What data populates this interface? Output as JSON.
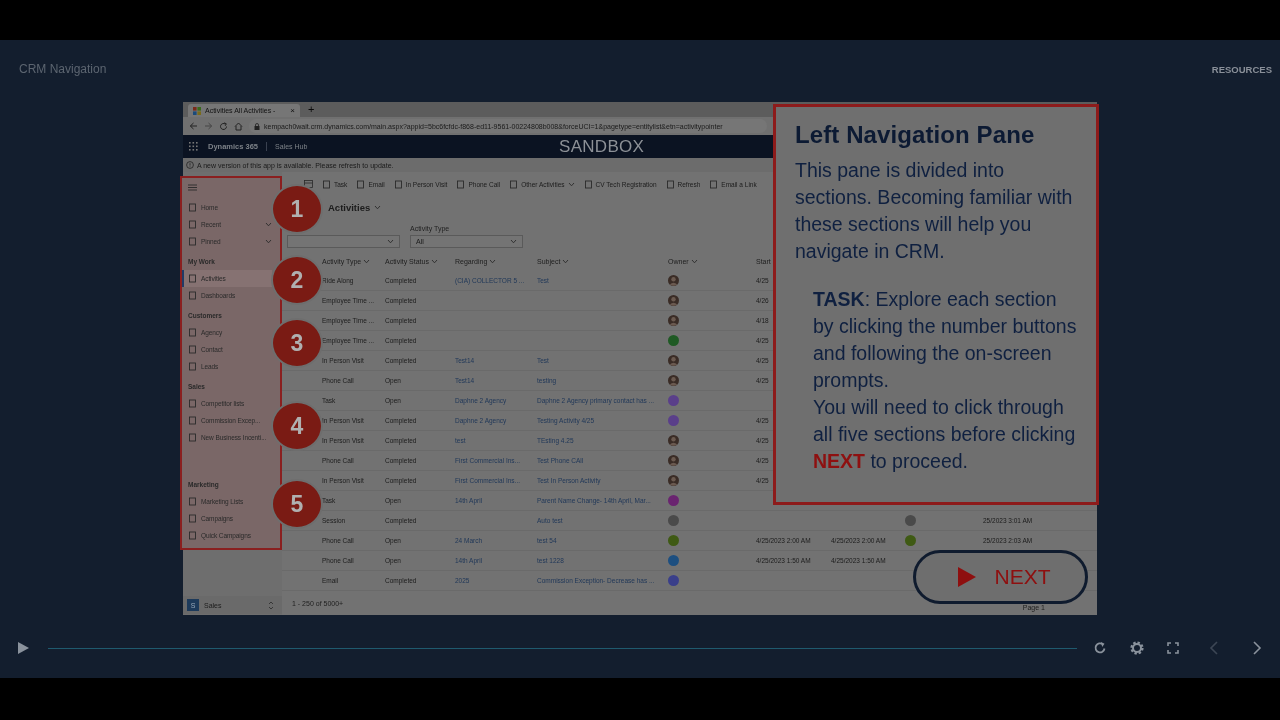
{
  "player": {
    "title": "CRM Navigation",
    "resources": "RESOURCES"
  },
  "browser": {
    "tab_title": "Activities All Activities -",
    "tab_close": "×",
    "new_tab": "+",
    "url": "kempach0wait.crm.dynamics.com/main.aspx?appid=5bc6fcfdc-f868-ed11-9561-00224808b008&forceUCI=1&pagetype=entitylist&etn=activitypointer"
  },
  "app_header": {
    "product": "Dynamics 365",
    "app": "Sales Hub",
    "environment": "SANDBOX"
  },
  "notification": "A new version of this app is available. Please refresh to update.",
  "sidebar": {
    "top_items": [
      {
        "label": "Home",
        "expandable": false
      },
      {
        "label": "Recent",
        "expandable": true
      },
      {
        "label": "Pinned",
        "expandable": true
      }
    ],
    "groups": [
      {
        "header": "My Work",
        "items": [
          {
            "label": "Activities",
            "selected": true
          },
          {
            "label": "Dashboards",
            "selected": false
          }
        ]
      },
      {
        "header": "Customers",
        "items": [
          {
            "label": "Agency",
            "selected": false
          },
          {
            "label": "Contact",
            "selected": false
          },
          {
            "label": "Leads",
            "selected": false
          }
        ]
      },
      {
        "header": "Sales",
        "items": [
          {
            "label": "Competitor lists",
            "selected": false
          },
          {
            "label": "Commission Excep...",
            "selected": false
          },
          {
            "label": "New Business Incenti...",
            "selected": false
          }
        ]
      },
      {
        "header": "Marketing",
        "items": [
          {
            "label": "Marketing Lists",
            "selected": false
          },
          {
            "label": "Campaigns",
            "selected": false
          },
          {
            "label": "Quick Campaigns",
            "selected": false
          }
        ]
      }
    ],
    "area_switcher": {
      "badge": "S",
      "label": "Sales"
    }
  },
  "command_bar": [
    "Task",
    "Email",
    "In Person Visit",
    "Phone Call",
    "Other Activities",
    "CV Tech Registration",
    "Refresh",
    "Email a Link"
  ],
  "view": {
    "title": "Activities",
    "filters": [
      {
        "kind": "dropdown"
      },
      {
        "kind": "dropdown",
        "label": "Activity Type",
        "value": "All"
      }
    ]
  },
  "table": {
    "columns": [
      "Activity Type",
      "Activity Status",
      "Regarding",
      "Subject",
      "Owner",
      "Start"
    ],
    "rows": [
      {
        "activity_type": "Ride Along",
        "activity_status": "Completed",
        "regarding": "(CIA) COLLECTOR 5 ...",
        "subject": "Test",
        "owner": {
          "kind": "photo"
        },
        "start": "4/25"
      },
      {
        "activity_type": "Employee Time ...",
        "activity_status": "Completed",
        "owner": {
          "kind": "photo"
        },
        "start": "4/26"
      },
      {
        "activity_type": "Employee Time ...",
        "activity_status": "Completed",
        "owner": {
          "kind": "photo"
        },
        "start": "4/18"
      },
      {
        "activity_type": "Employee Time ...",
        "activity_status": "Completed",
        "owner": {
          "kind": "initials",
          "color": "#1f5a24"
        },
        "start": "4/25"
      },
      {
        "activity_type": "In Person Visit",
        "activity_status": "Completed",
        "regarding": "Test14",
        "subject": "Test",
        "owner": {
          "kind": "photo"
        },
        "start": "4/25"
      },
      {
        "activity_type": "Phone Call",
        "activity_status": "Open",
        "regarding": "Test14",
        "subject": "testing",
        "owner": {
          "kind": "photo"
        },
        "start": "4/25"
      },
      {
        "activity_type": "Task",
        "activity_status": "Open",
        "regarding": "Daphne 2 Agency",
        "subject": "Daphne 2 Agency primary contact has ...",
        "owner": {
          "kind": "initials",
          "color": "#5a3f8a"
        }
      },
      {
        "activity_type": "In Person Visit",
        "activity_status": "Completed",
        "regarding": "Daphne 2 Agency",
        "subject": "Testing Activity 4/25",
        "owner": {
          "kind": "initials",
          "color": "#5a3f8a"
        },
        "start": "4/25"
      },
      {
        "activity_type": "In Person Visit",
        "activity_status": "Completed",
        "regarding": "test",
        "subject": "TEsting 4.25",
        "owner": {
          "kind": "photo"
        },
        "start": "4/25"
      },
      {
        "activity_type": "Phone Call",
        "activity_status": "Completed",
        "regarding": "First Commercial Ins...",
        "subject": "Test Phone CAll",
        "owner": {
          "kind": "photo"
        },
        "start": "4/25"
      },
      {
        "activity_type": "In Person Visit",
        "activity_status": "Completed",
        "regarding": "First Commercial Ins...",
        "subject": "Test In Person Activity",
        "owner": {
          "kind": "photo"
        },
        "start": "4/25"
      },
      {
        "activity_type": "Task",
        "activity_status": "Open",
        "regarding": "14th April",
        "subject": "Parent Name Change- 14th April, Mar...",
        "owner": {
          "kind": "initials",
          "color": "#6a2470"
        }
      },
      {
        "activity_type": "Session",
        "activity_status": "Completed",
        "subject": "Auto test",
        "owner": {
          "kind": "initials",
          "color": "#4a4a4a"
        },
        "column_8": {
          "kind": "initials",
          "color": "#4a4a4a"
        },
        "column_9": "25/2023 3:01 AM"
      },
      {
        "activity_type": "Phone Call",
        "activity_status": "Open",
        "regarding": "24 March",
        "subject": "test 54",
        "owner": {
          "kind": "initials",
          "color": "#3f5a14"
        },
        "start": "4/25/2023 2:00 AM",
        "column_7": "4/25/2023 2:00 AM",
        "column_8": {
          "kind": "initials",
          "color": "#3f5a14"
        },
        "column_9": "25/2023 2:03 AM"
      },
      {
        "activity_type": "Phone Call",
        "activity_status": "Open",
        "regarding": "14th April",
        "subject": "test 1228",
        "owner": {
          "kind": "initials",
          "color": "#1d4f80"
        },
        "start": "4/25/2023 1:50 AM",
        "column_7": "4/25/2023 1:50 AM"
      },
      {
        "activity_type": "Email",
        "activity_status": "Completed",
        "regarding": "2025",
        "subject": "Commission Exception- Decrease has ...",
        "owner": {
          "kind": "initials",
          "color": "#3a3f8a"
        }
      }
    ]
  },
  "footer": {
    "count": "1 - 250 of 5000+",
    "page": "Page 1"
  },
  "markers": [
    "1",
    "2",
    "3",
    "4",
    "5"
  ],
  "callout": {
    "title": "Left Navigation Pane",
    "intro": "This pane is divided into sections. Becoming familiar with these sections will help you navigate in CRM.",
    "task": "**TASK**: Explore each section by clicking the number buttons and following the on-screen prompts.",
    "instruction": "You will need to click through all five sections before clicking **NEXT** to proceed."
  },
  "next_button": "NEXT",
  "controls": [
    {
      "kind": "play",
      "disabled": false
    },
    {
      "kind": "progress"
    },
    {
      "kind": "replay",
      "disabled": false
    },
    {
      "kind": "settings",
      "disabled": false
    },
    {
      "kind": "fullscreen",
      "disabled": false
    },
    {
      "kind": "previous",
      "disabled": true
    },
    {
      "kind": "next",
      "disabled": false
    }
  ]
}
